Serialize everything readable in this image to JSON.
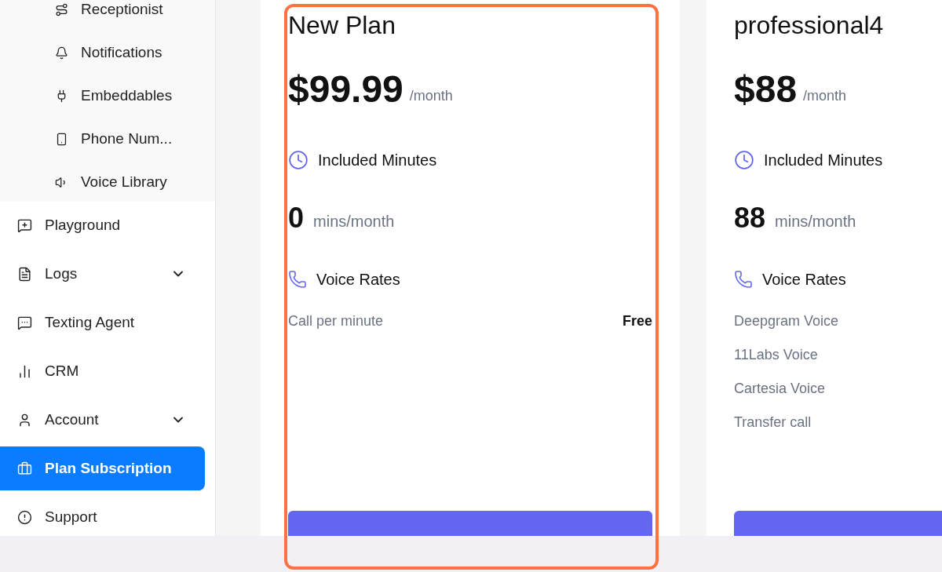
{
  "sidebar": {
    "sub_items": [
      {
        "label": "Receptionist"
      },
      {
        "label": "Notifications"
      },
      {
        "label": "Embeddables"
      },
      {
        "label": "Phone Num..."
      },
      {
        "label": "Voice Library"
      }
    ],
    "items": [
      {
        "label": "Playground",
        "selected": false,
        "expandable": false
      },
      {
        "label": "Logs",
        "selected": false,
        "expandable": true
      },
      {
        "label": "Texting Agent",
        "selected": false,
        "expandable": false
      },
      {
        "label": "CRM",
        "selected": false,
        "expandable": false
      },
      {
        "label": "Account",
        "selected": false,
        "expandable": true
      },
      {
        "label": "Plan Subscription",
        "selected": true,
        "expandable": false
      },
      {
        "label": "Support",
        "selected": false,
        "expandable": false
      }
    ]
  },
  "plans": [
    {
      "name": "New Plan",
      "price": "$99.99",
      "period": "/month",
      "minutes_label": "Included Minutes",
      "minutes": "0",
      "minutes_unit": "mins/month",
      "rates_label": "Voice Rates",
      "rates": [
        {
          "label": "Call per minute",
          "value": "Free"
        }
      ],
      "highlighted": true
    },
    {
      "name": "professional4",
      "price": "$88",
      "period": "/month",
      "minutes_label": "Included Minutes",
      "minutes": "88",
      "minutes_unit": "mins/month",
      "rates_label": "Voice Rates",
      "rates": [
        {
          "label": "Deepgram Voice"
        },
        {
          "label": "11Labs Voice"
        },
        {
          "label": "Cartesia Voice"
        },
        {
          "label": "Transfer call"
        }
      ],
      "highlighted": false
    }
  ]
}
